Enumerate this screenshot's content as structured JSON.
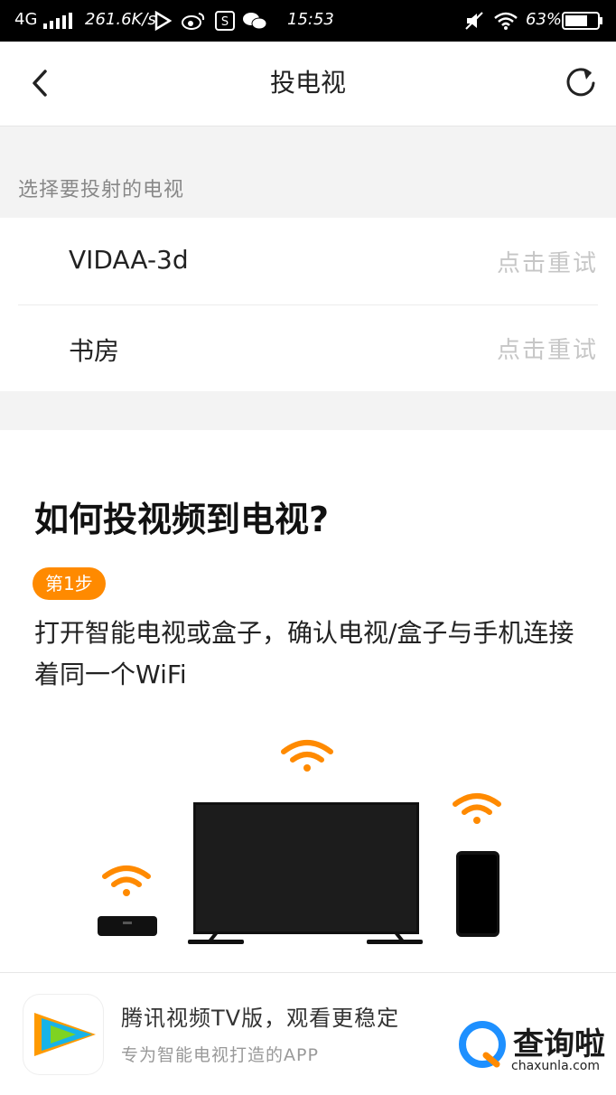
{
  "status_bar": {
    "network": "4G",
    "speed": "261.6K/s",
    "time": "15:53",
    "battery": "63%"
  },
  "nav": {
    "title": "投电视",
    "back_icon": "chevron-left-icon",
    "refresh_icon": "refresh-icon"
  },
  "device_section": {
    "label": "选择要投射的电视",
    "devices": [
      {
        "name": "VIDAA-3d",
        "action": "点击重试"
      },
      {
        "name": "书房",
        "action": "点击重试"
      }
    ]
  },
  "guide": {
    "title": "如何投视频到电视?",
    "step_badge": "第1步",
    "step_text": "打开智能电视或盒子，确认电视/盒子与手机连接着同一个WiFi"
  },
  "colors": {
    "accent": "#ff8a00",
    "retry_text": "#c6c6c6",
    "section_bg": "#f3f3f3"
  },
  "banner": {
    "title": "腾讯视频TV版，观看更稳定",
    "subtitle": "专为智能电视打造的APP"
  },
  "watermark": {
    "name": "查询啦",
    "url": "chaxunla.com"
  }
}
